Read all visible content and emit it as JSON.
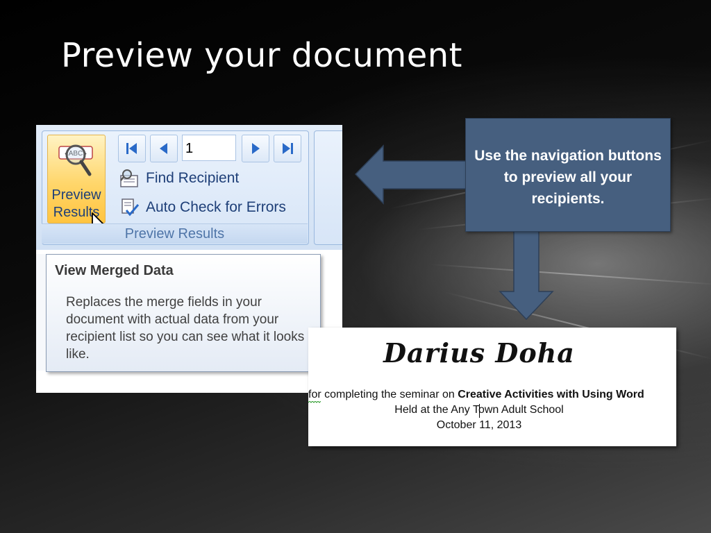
{
  "slide": {
    "title": "Preview your document"
  },
  "ribbon": {
    "preview_button": {
      "label_line1": "Preview",
      "label_line2": "Results",
      "icon": "abc-magnifier-icon"
    },
    "record_value": "1",
    "commands": {
      "find_recipient": "Find Recipient",
      "auto_check": "Auto Check for Errors"
    },
    "group_label": "Preview Results",
    "icons": [
      "first-record-icon",
      "previous-record-icon",
      "next-record-icon",
      "last-record-icon",
      "find-recipient-icon",
      "auto-check-icon",
      "mouse-pointer-icon"
    ]
  },
  "tooltip": {
    "title": "View Merged Data",
    "body": "Replaces the merge fields in your document with actual data from your recipient list so you can see what it looks like."
  },
  "callout": {
    "text": "Use the navigation buttons to preview all your recipients."
  },
  "certificate": {
    "name": "Darius Doha",
    "line1_prefix": "for completing the seminar on ",
    "line1_bold": "Creative Activities with Using Word",
    "line2": "Held at the Any Town Adult School",
    "line3": "October 11, 2013"
  },
  "colors": {
    "callout_fill": "#465f7f",
    "ribbon_blue": "#1e3f78",
    "preview_highlight": "#ffd66b"
  }
}
